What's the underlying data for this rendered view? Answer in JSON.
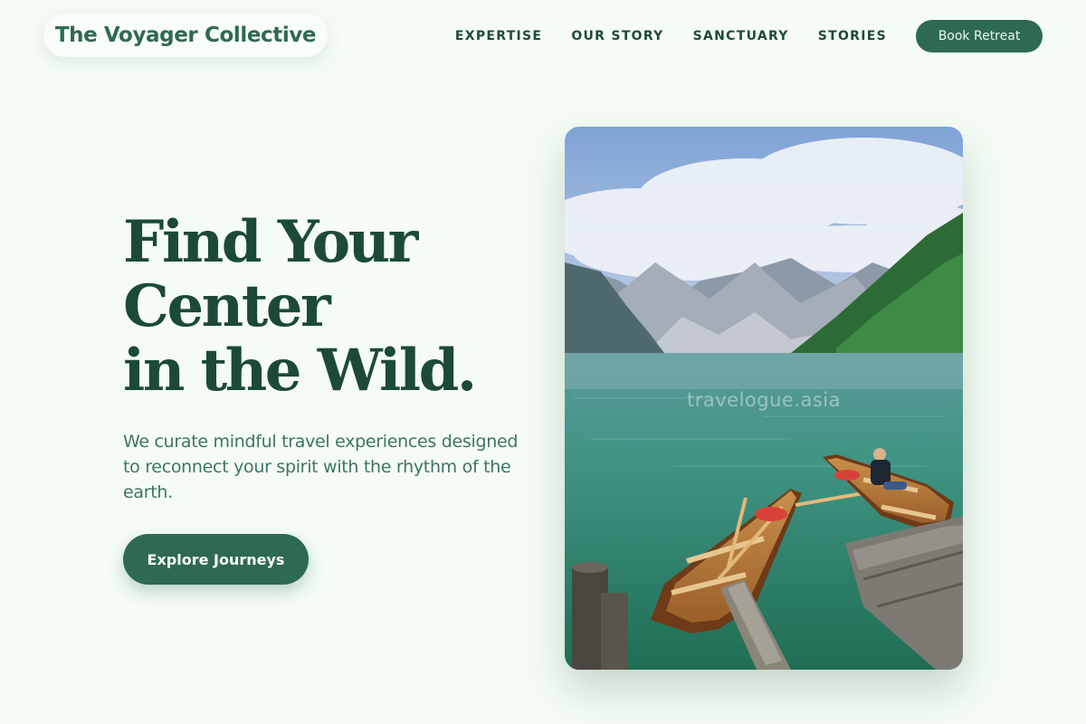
{
  "brand": {
    "name": "The Voyager Collective"
  },
  "nav": {
    "links": [
      "EXPERTISE",
      "OUR STORY",
      "SANCTUARY",
      "STORIES"
    ],
    "cta_label": "Book Retreat"
  },
  "hero": {
    "title_lines": [
      "Find Your",
      "Center",
      "in the Wild."
    ],
    "subtitle": "We curate mindful travel experiences designed to reconnect your spirit with the rhythm of the earth.",
    "cta_label": "Explore Journeys"
  },
  "photo": {
    "watermark": "travelogue.asia"
  },
  "colors": {
    "background": "#f4fcf5",
    "primary": "#2e6a4f",
    "heading": "#1c4a35",
    "body_text": "#3d7560"
  }
}
